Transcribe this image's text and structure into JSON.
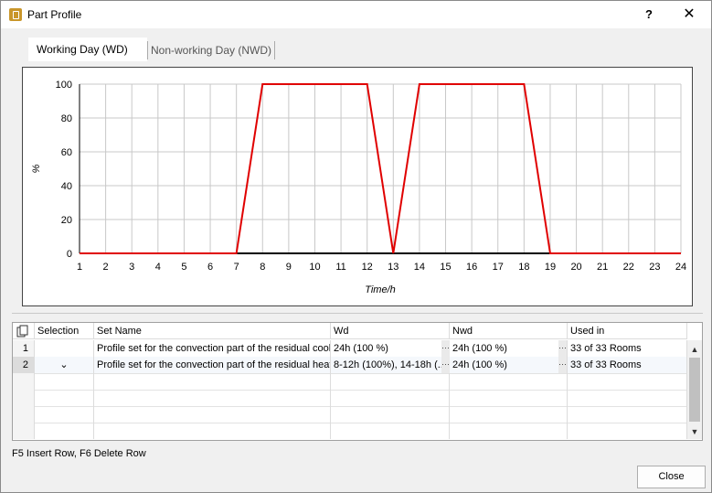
{
  "window": {
    "title": "Part Profile",
    "help": "?",
    "close": "✕"
  },
  "tabs": [
    {
      "label": "Working Day (WD)",
      "active": true
    },
    {
      "label": "Non-working Day (NWD)",
      "active": false
    }
  ],
  "chart_data": {
    "type": "line",
    "title": "",
    "xlabel": "Time/h",
    "ylabel": "%",
    "xlim": [
      1,
      24
    ],
    "ylim": [
      0,
      100
    ],
    "x_ticks": [
      1,
      2,
      3,
      4,
      5,
      6,
      7,
      8,
      9,
      10,
      11,
      12,
      13,
      14,
      15,
      16,
      17,
      18,
      19,
      20,
      21,
      22,
      23,
      24
    ],
    "y_ticks": [
      0,
      20,
      40,
      60,
      80,
      100
    ],
    "grid": true,
    "series": [
      {
        "color": "#e00000",
        "points": [
          [
            1,
            0
          ],
          [
            7,
            0
          ],
          [
            8,
            100
          ],
          [
            12,
            100
          ],
          [
            13,
            0
          ],
          [
            14,
            100
          ],
          [
            18,
            100
          ],
          [
            19,
            0
          ],
          [
            24,
            0
          ]
        ]
      }
    ]
  },
  "table": {
    "columns": [
      "Selection",
      "Set Name",
      "Wd",
      "Nwd",
      "Used in"
    ],
    "rows": [
      {
        "num": "1",
        "selection": "",
        "set_name": "Profile set for the convection part of the residual cool...",
        "wd": "24h (100 %)",
        "nwd": "24h (100 %)",
        "used_in": "33 of 33 Rooms"
      },
      {
        "num": "2",
        "selection": "⌄",
        "set_name": "Profile set for the convection part of the residual heat...",
        "wd": "8-12h (100%), 14-18h (...",
        "nwd": "24h (100 %)",
        "used_in": "33 of 33 Rooms"
      }
    ],
    "ellipsis": "···"
  },
  "status_text": "F5 Insert Row, F6 Delete Row",
  "buttons": {
    "close": "Close"
  }
}
